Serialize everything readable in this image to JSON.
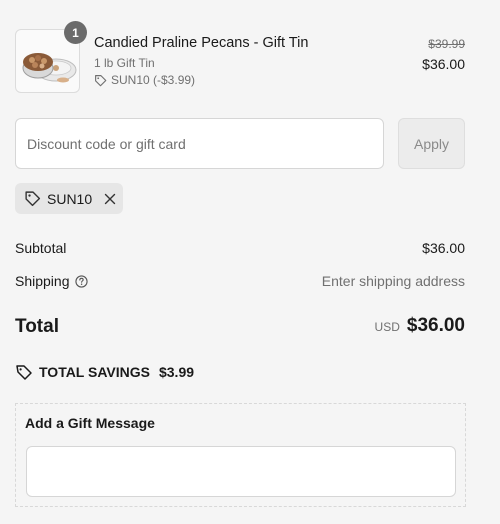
{
  "product": {
    "quantity": "1",
    "title": "Candied Praline Pecans - Gift Tin",
    "variant": "1 lb Gift Tin",
    "discount": "SUN10 (-$3.99)",
    "price_original": "$39.99",
    "price_final": "$36.00",
    "image_icon": "pecan-tin-image"
  },
  "discount": {
    "placeholder": "Discount code or gift card",
    "value": "",
    "apply_label": "Apply",
    "applied_code": "SUN10"
  },
  "summary": {
    "subtotal_label": "Subtotal",
    "subtotal_value": "$36.00",
    "shipping_label": "Shipping",
    "shipping_value": "Enter shipping address",
    "total_label": "Total",
    "currency": "USD",
    "total_value": "$36.00",
    "savings_label": "TOTAL SAVINGS",
    "savings_value": "$3.99"
  },
  "gift": {
    "title": "Add a Gift Message",
    "value": ""
  },
  "colors": {
    "background": "#f5f5f5",
    "badge": "#6b6b6b",
    "muted_text": "#707070",
    "tag_bg": "#e6e6e6"
  }
}
